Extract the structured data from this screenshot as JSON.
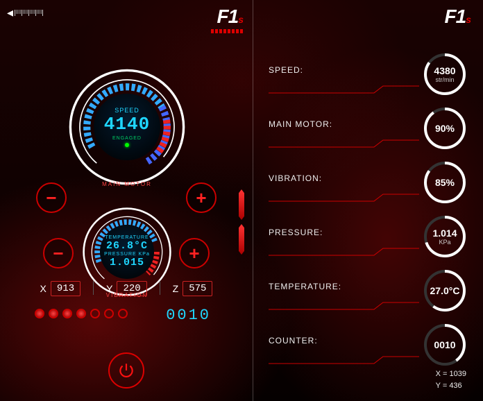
{
  "logo": {
    "text": "F1",
    "sub": "s"
  },
  "main_gauge": {
    "name": "MAIN MOTOR",
    "label": "SPEED",
    "value": "4140",
    "status": "ENGAGED"
  },
  "vib_gauge": {
    "name": "VIBRATION",
    "temp_label": "TEMPERATURE",
    "temp_value": "26.8°C",
    "press_label": "PRESSURE KPa",
    "press_value": "1.015"
  },
  "controls": {
    "minus": "−",
    "plus": "+"
  },
  "coords": {
    "x_label": "X",
    "x": "913",
    "y_label": "Y",
    "y": "220",
    "z_label": "Z",
    "z": "575"
  },
  "dots": [
    true,
    true,
    true,
    true,
    false,
    false,
    false
  ],
  "counter": "0010",
  "stats": [
    {
      "label": "SPEED:",
      "value": "4380",
      "unit": "str/min",
      "pct": 85
    },
    {
      "label": "MAIN MOTOR:",
      "value": "90%",
      "unit": "",
      "pct": 90
    },
    {
      "label": "VIBRATION:",
      "value": "85%",
      "unit": "",
      "pct": 85
    },
    {
      "label": "PRESSURE:",
      "value": "1.014",
      "unit": "KPa",
      "pct": 70
    },
    {
      "label": "TEMPERATURE:",
      "value": "27.0°C",
      "unit": "",
      "pct": 60
    },
    {
      "label": "COUNTER:",
      "value": "0010",
      "unit": "",
      "pct": 40
    }
  ],
  "right_coords": {
    "x_label": "X =",
    "x": "1039",
    "y_label": "Y =",
    "y": "436"
  }
}
